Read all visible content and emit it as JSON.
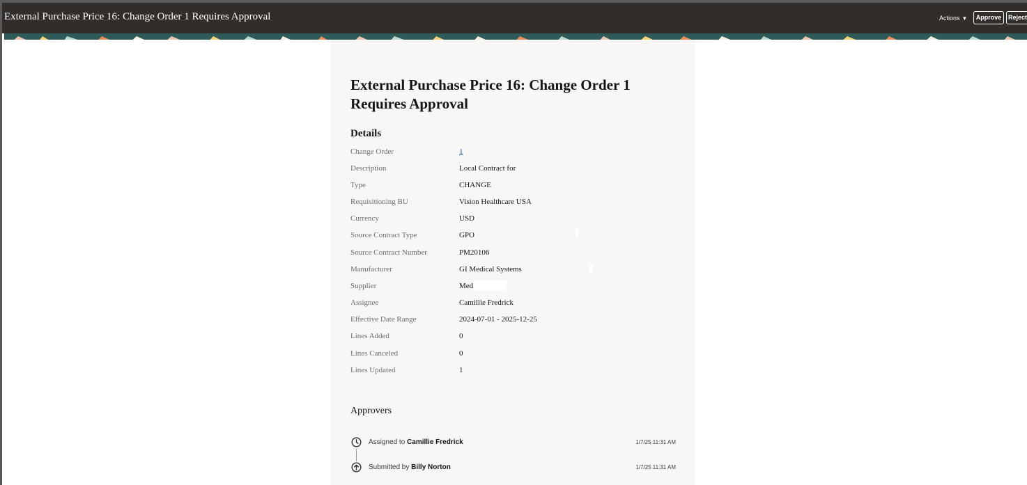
{
  "topbar": {
    "title": "External Purchase Price 16: Change Order 1 Requires Approval",
    "actions_label": "Actions",
    "approve_label": "Approve",
    "reject_label": "Reject",
    "background": "#312d2a"
  },
  "card": {
    "heading": "External Purchase Price 16: Change Order 1 Requires Approval",
    "details_title": "Details",
    "details": [
      {
        "label": "Change Order",
        "value": "1"
      },
      {
        "label": "Description",
        "value": "Local Contract for"
      },
      {
        "label": "Type",
        "value": "CHANGE"
      },
      {
        "label": "Requisitioning BU",
        "value": "Vision Healthcare USA"
      },
      {
        "label": "Currency",
        "value": "USD"
      },
      {
        "label": "Source Contract Type",
        "value": "GPO"
      },
      {
        "label": "Source Contract Number",
        "value": "PM20106"
      },
      {
        "label": "Manufacturer",
        "value": "GI  Medical Systems"
      },
      {
        "label": "Supplier",
        "value": "Med"
      },
      {
        "label": "Assignee",
        "value": "Camillie Fredrick"
      },
      {
        "label": "Effective Date Range",
        "value": "2024-07-01 - 2025-12-25"
      },
      {
        "label": "Lines Added",
        "value": "0"
      },
      {
        "label": "Lines Canceled",
        "value": "0"
      },
      {
        "label": "Lines Updated",
        "value": "1"
      }
    ],
    "approvers_title": "Approvers",
    "approvers": [
      {
        "prefix": "Assigned to",
        "name": "Camillie Fredrick",
        "time": "1/7/25 11:31 AM",
        "icon": "clock-icon"
      },
      {
        "prefix": "Submitted by",
        "name": "Billy Norton",
        "time": "1/7/25 11:31 AM",
        "icon": "arrow-up-circle-icon"
      }
    ]
  },
  "colors": {
    "link": "#1a5ca8",
    "card_background": "#f8f7f5",
    "label": "#6f6c69"
  }
}
